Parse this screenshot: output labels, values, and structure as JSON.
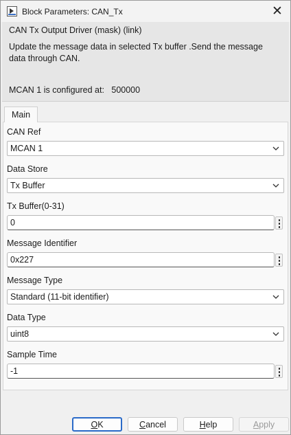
{
  "window": {
    "title": "Block Parameters: CAN_Tx"
  },
  "description": {
    "title": "CAN Tx Output Driver (mask) (link)",
    "text": "Update the message data in selected Tx buffer .Send the message data through CAN.",
    "config_label": "MCAN 1 is configured at:",
    "config_value": "500000"
  },
  "tabs": [
    {
      "label": "Main",
      "selected": true
    }
  ],
  "fields": {
    "can_ref": {
      "label": "CAN Ref",
      "value": "MCAN 1"
    },
    "data_store": {
      "label": "Data Store",
      "value": "Tx Buffer"
    },
    "tx_buffer": {
      "label": "Tx Buffer(0-31)",
      "value": "0"
    },
    "message_identifier": {
      "label": "Message Identifier",
      "value": "0x227"
    },
    "message_type": {
      "label": "Message Type",
      "value": "Standard (11-bit identifier)"
    },
    "data_type": {
      "label": "Data Type",
      "value": "uint8"
    },
    "sample_time": {
      "label": "Sample Time",
      "value": "-1"
    }
  },
  "buttons": {
    "ok": {
      "first": "O",
      "rest": "K"
    },
    "cancel": {
      "first": "C",
      "rest": "ancel"
    },
    "help": {
      "first": "H",
      "rest": "elp"
    },
    "apply": {
      "first": "A",
      "rest": "pply",
      "disabled": true
    }
  },
  "colors": {
    "accent": "#2a6ac8",
    "window_bg": "#f0f0f0",
    "panel_bg": "#f9f9f9",
    "description_bg": "#e6e6e6"
  },
  "icons": [
    "block-parameters-icon",
    "close-icon",
    "chevron-down-icon",
    "kebab-menu-icon"
  ]
}
